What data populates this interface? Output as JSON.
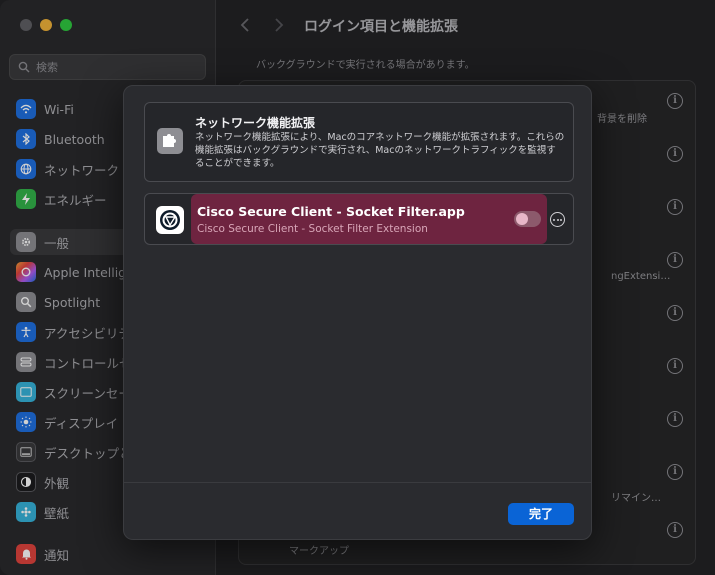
{
  "window": {
    "title": "ログイン項目と機能拡張"
  },
  "sidebar": {
    "search_placeholder": "検索",
    "items": [
      {
        "label": "Wi-Fi",
        "icon": "wifi-icon",
        "color": "#1f6fe0"
      },
      {
        "label": "Bluetooth",
        "icon": "bluetooth-icon",
        "color": "#1f6fe0"
      },
      {
        "label": "ネットワーク",
        "icon": "globe-icon",
        "color": "#1f6fe0"
      },
      {
        "label": "エネルギー",
        "icon": "battery-icon",
        "color": "#33b34a"
      },
      {
        "label": "一般",
        "icon": "gear-icon",
        "color": "#8e8e93"
      },
      {
        "label": "Apple Intellig",
        "icon": "apple-intelligence-icon",
        "color": "#b05cf0"
      },
      {
        "label": "Spotlight",
        "icon": "magnifier-icon",
        "color": "#8e8e93"
      },
      {
        "label": "アクセシビリテ",
        "icon": "accessibility-icon",
        "color": "#1f6fe0"
      },
      {
        "label": "コントロールセ",
        "icon": "control-center-icon",
        "color": "#8e8e93"
      },
      {
        "label": "スクリーンセー",
        "icon": "screensaver-icon",
        "color": "#36b3d9"
      },
      {
        "label": "ディスプレイ",
        "icon": "display-icon",
        "color": "#1f6fe0"
      },
      {
        "label": "デスクトップと",
        "icon": "dock-icon",
        "color": "#3a3a3c"
      },
      {
        "label": "外観",
        "icon": "appearance-icon",
        "color": "#1c1c1e"
      },
      {
        "label": "壁紙",
        "icon": "wallpaper-icon",
        "color": "#36b3d9"
      },
      {
        "label": "通知",
        "icon": "bell-icon",
        "color": "#e0443e"
      }
    ]
  },
  "main": {
    "note": "バックグラウンドで実行される場合があります。",
    "fragments": {
      "remove_background": "背景を削除",
      "extension_tail": "ngExtensi…",
      "reminder_tail": "リマイン…",
      "markup": "マークアップ"
    }
  },
  "sheet": {
    "heading": "ネットワーク機能拡張",
    "description": "ネットワーク機能拡張により、Macのコアネットワーク機能が拡張されます。これらの機能拡張はバックグラウンドで実行され、Macのネットワークトラフィックを監視することができます。",
    "item": {
      "name": "Cisco Secure Client - Socket Filter.app",
      "subtitle": "Cisco Secure Client - Socket Filter Extension",
      "enabled": false
    },
    "done_label": "完了"
  },
  "colors": {
    "accent": "#0a64d6",
    "highlight": "#6e2440"
  }
}
